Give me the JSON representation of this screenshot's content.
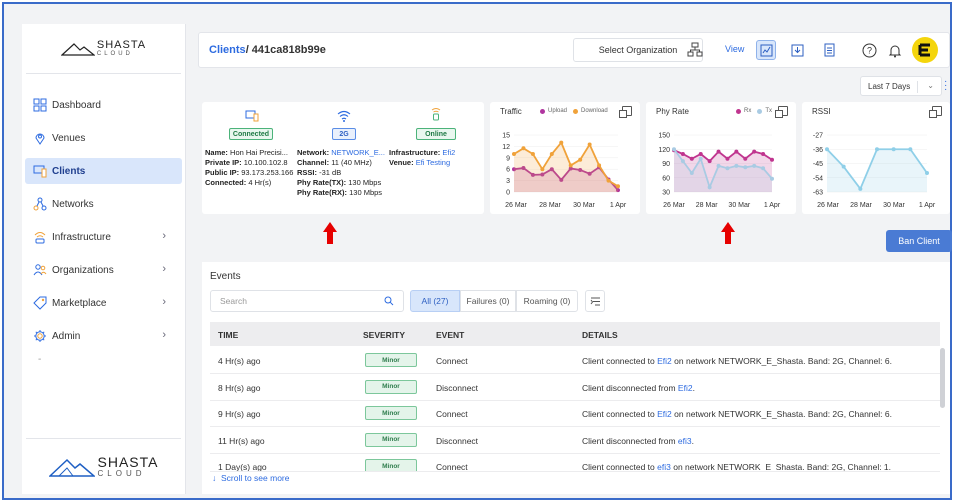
{
  "brand": {
    "name": "SHASTA",
    "sub": "CLOUD"
  },
  "sidebar": {
    "items": [
      {
        "label": "Dashboard",
        "icon": "grid-icon",
        "chevron": false,
        "active": false
      },
      {
        "label": "Venues",
        "icon": "location-pin-icon",
        "chevron": false,
        "active": false
      },
      {
        "label": "Clients",
        "icon": "devices-icon",
        "chevron": false,
        "active": true
      },
      {
        "label": "Networks",
        "icon": "network-nodes-icon",
        "chevron": false,
        "active": false
      },
      {
        "label": "Infrastructure",
        "icon": "access-point-icon",
        "chevron": true,
        "active": false
      },
      {
        "label": "Organizations",
        "icon": "people-icon",
        "chevron": true,
        "active": false
      },
      {
        "label": "Marketplace",
        "icon": "tag-icon",
        "chevron": true,
        "active": false
      },
      {
        "label": "Admin",
        "icon": "gear-icon",
        "chevron": true,
        "active": false
      }
    ],
    "dash": "-"
  },
  "header": {
    "crumb_link": "Clients",
    "crumb_rest": "/ 441ca818b99e",
    "org_select": "Select Organization",
    "view_label": "View"
  },
  "daterange": {
    "value": "Last 7 Days"
  },
  "client": {
    "status_connected": "Connected",
    "band": "2G",
    "status_online": "Online",
    "name_label": "Name:",
    "name_value": "Hon Hai Precisi...",
    "private_ip_label": "Private IP:",
    "private_ip_value": "10.100.102.8",
    "public_ip_label": "Public IP:",
    "public_ip_value": "93.173.253.166",
    "connected_label": "Connected:",
    "connected_value": "4 Hr(s)",
    "network_label": "Network:",
    "network_value": "NETWORK_E...",
    "channel_label": "Channel:",
    "channel_value": "11 (40 MHz)",
    "rssi_label": "RSSI:",
    "rssi_value": "-31 dB",
    "phytx_label": "Phy Rate(TX):",
    "phytx_value": "130 Mbps",
    "phyrx_label": "Phy Rate(RX):",
    "phyrx_value": "130 Mbps",
    "infra_label": "Infrastructure:",
    "infra_value": "Efi2",
    "venue_label": "Venue:",
    "venue_value": "Efi Testing"
  },
  "chart_data": [
    {
      "type": "area",
      "title": "Traffic",
      "categories": [
        "26 Mar",
        "28 Mar",
        "30 Mar",
        "1 Apr"
      ],
      "yticks": [
        0,
        3,
        6,
        9,
        12,
        15
      ],
      "ylim": [
        0,
        15
      ],
      "series": [
        {
          "name": "Upload",
          "color": "#b0359f",
          "values": [
            6,
            6.3,
            4.5,
            4.6,
            6,
            3.2,
            6.2,
            5.8,
            4.8,
            6.5,
            3.3,
            0.5
          ]
        },
        {
          "name": "Download",
          "color": "#f0a23a",
          "values": [
            10,
            11.5,
            10,
            6,
            10,
            13,
            7,
            8.5,
            12.5,
            7,
            3,
            1.5
          ]
        }
      ]
    },
    {
      "type": "area",
      "title": "Phy Rate",
      "categories": [
        "26 Mar",
        "28 Mar",
        "30 Mar",
        "1 Apr"
      ],
      "yticks": [
        30,
        60,
        90,
        120,
        150
      ],
      "ylim": [
        30,
        150
      ],
      "series": [
        {
          "name": "Rx",
          "color": "#c0358f",
          "values": [
            118,
            110,
            100,
            110,
            95,
            115,
            100,
            115,
            100,
            115,
            110,
            98
          ]
        },
        {
          "name": "Tx",
          "color": "#a9cbe3",
          "values": [
            120,
            95,
            70,
            100,
            40,
            85,
            80,
            85,
            82,
            85,
            80,
            58
          ]
        }
      ]
    },
    {
      "type": "area",
      "title": "RSSI",
      "categories": [
        "26 Mar",
        "28 Mar",
        "30 Mar",
        "1 Apr"
      ],
      "yticks": [
        -63,
        -54,
        -45,
        -36,
        -27
      ],
      "ylim": [
        -63,
        -27
      ],
      "series": [
        {
          "name": "",
          "color": "#8fcfe8",
          "values": [
            -36,
            -47,
            -61,
            -36,
            -36,
            -36,
            -51
          ]
        }
      ]
    }
  ],
  "actions": {
    "ban": "Ban Client"
  },
  "events": {
    "title": "Events",
    "search_placeholder": "Search",
    "filters": [
      "All (27)",
      "Failures (0)",
      "Roaming (0)"
    ],
    "columns": [
      "TIME",
      "SEVERITY",
      "EVENT",
      "DETAILS"
    ],
    "rows": [
      {
        "time": "4 Hr(s) ago",
        "severity": "Minor",
        "event": "Connect",
        "pre": "Client connected to ",
        "link": "Efi2",
        "post": " on network NETWORK_E_Shasta. Band: 2G, Channel: 6."
      },
      {
        "time": "8 Hr(s) ago",
        "severity": "Minor",
        "event": "Disconnect",
        "pre": "Client disconnected from ",
        "link": "Efi2",
        "post": "."
      },
      {
        "time": "9 Hr(s) ago",
        "severity": "Minor",
        "event": "Connect",
        "pre": "Client connected to ",
        "link": "Efi2",
        "post": " on network NETWORK_E_Shasta. Band: 2G, Channel: 6."
      },
      {
        "time": "11 Hr(s) ago",
        "severity": "Minor",
        "event": "Disconnect",
        "pre": "Client disconnected from ",
        "link": "efi3",
        "post": "."
      },
      {
        "time": "1 Day(s) ago",
        "severity": "Minor",
        "event": "Connect",
        "pre": "Client connected to ",
        "link": "efi3",
        "post": " on network NETWORK_E_Shasta. Band: 2G, Channel: 1."
      }
    ],
    "scroll_more": "Scroll to see more"
  },
  "colors": {
    "accent": "#2d6be0",
    "button": "#4a7bd4",
    "annotation_arrow": "#e60000"
  }
}
